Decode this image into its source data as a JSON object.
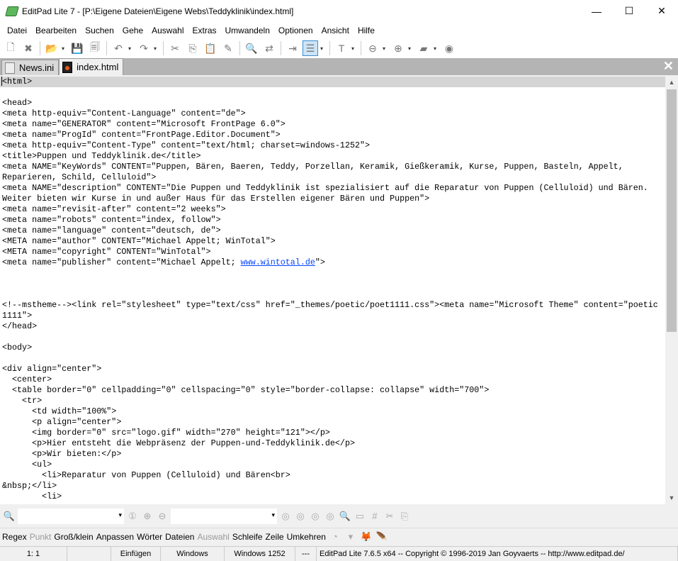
{
  "window": {
    "title": "EditPad Lite 7 - [P:\\Eigene Dateien\\Eigene Webs\\Teddyklinik\\index.html]",
    "minimize": "—",
    "maximize": "☐",
    "close": "✕"
  },
  "menu": [
    "Datei",
    "Bearbeiten",
    "Suchen",
    "Gehe",
    "Auswahl",
    "Extras",
    "Umwandeln",
    "Optionen",
    "Ansicht",
    "Hilfe"
  ],
  "toolbar": [
    {
      "name": "new-file-icon",
      "g": "🗋"
    },
    {
      "name": "close-file-icon",
      "g": "✖"
    },
    {
      "sep": true
    },
    {
      "name": "open-file-icon",
      "g": "📂",
      "dd": true
    },
    {
      "name": "save-icon",
      "g": "💾"
    },
    {
      "name": "save-all-icon",
      "g": "🗐"
    },
    {
      "sep": true
    },
    {
      "name": "undo-icon",
      "g": "↶",
      "dd": true
    },
    {
      "name": "redo-icon",
      "g": "↷",
      "dd": true
    },
    {
      "sep": true
    },
    {
      "name": "cut-icon",
      "g": "✂"
    },
    {
      "name": "copy-icon",
      "g": "⎘"
    },
    {
      "name": "paste-icon",
      "g": "📋"
    },
    {
      "name": "edit-icon",
      "g": "✎"
    },
    {
      "sep": true
    },
    {
      "name": "search-icon",
      "g": "🔍"
    },
    {
      "name": "replace-icon",
      "g": "⇄"
    },
    {
      "sep": true
    },
    {
      "name": "indent-icon",
      "g": "⇥"
    },
    {
      "name": "word-wrap-icon",
      "g": "☰",
      "sel": true,
      "dd": true
    },
    {
      "sep": true
    },
    {
      "name": "font-icon",
      "g": "T",
      "dd": true
    },
    {
      "sep": true
    },
    {
      "name": "back-icon",
      "g": "⊖",
      "dd": true
    },
    {
      "name": "forward-icon",
      "g": "⊕",
      "dd": true
    },
    {
      "name": "clip-collection-icon",
      "g": "▰",
      "dd": true
    },
    {
      "name": "web-globe-icon",
      "g": "◉"
    }
  ],
  "tabs": [
    {
      "label": "News.ini",
      "active": false
    },
    {
      "label": "index.html",
      "active": true
    }
  ],
  "tab_close": "✕",
  "editor": {
    "lines": [
      {
        "t": "<html>"
      },
      {
        "t": ""
      },
      {
        "t": "<head>"
      },
      {
        "t": "<meta http-equiv=\"Content-Language\" content=\"de\">"
      },
      {
        "t": "<meta name=\"GENERATOR\" content=\"Microsoft FrontPage 6.0\">"
      },
      {
        "t": "<meta name=\"ProgId\" content=\"FrontPage.Editor.Document\">"
      },
      {
        "t": "<meta http-equiv=\"Content-Type\" content=\"text/html; charset=windows-1252\">"
      },
      {
        "t": "<title>Puppen und Teddyklinik.de</title>"
      },
      {
        "t": "<meta NAME=\"KeyWords\" CONTENT=\"Puppen, Bären, Baeren, Teddy, Porzellan, Keramik, Gießkeramik, Kurse, Puppen, Basteln, Appelt,"
      },
      {
        "t": "Reparieren, Schild, Celluloid\">"
      },
      {
        "t": "<meta NAME=\"description\" CONTENT=\"Die Puppen und Teddyklinik ist spezialisiert auf die Reparatur von Puppen (Celluloid) und Bären."
      },
      {
        "t": "Weiter bieten wir Kurse in und außer Haus für das Erstellen eigener Bären und Puppen\">"
      },
      {
        "t": "<meta name=\"revisit-after\" content=\"2 weeks\">"
      },
      {
        "t": "<meta name=\"robots\" content=\"index, follow\">"
      },
      {
        "t": "<meta name=\"language\" content=\"deutsch, de\">"
      },
      {
        "t": "<META name=\"author\" CONTENT=\"Michael Appelt; WinTotal\">"
      },
      {
        "t": "<META name=\"copyright\" CONTENT=\"WinTotal\">"
      },
      {
        "t": "<meta name=\"publisher\" content=\"Michael Appelt; ",
        "link": "www.wintotal.de",
        "after": "\">"
      },
      {
        "t": ""
      },
      {
        "t": ""
      },
      {
        "t": ""
      },
      {
        "t": "<!--mstheme--><link rel=\"stylesheet\" type=\"text/css\" href=\"_themes/poetic/poet1111.css\"><meta name=\"Microsoft Theme\" content=\"poetic"
      },
      {
        "t": "1111\">"
      },
      {
        "t": "</head>"
      },
      {
        "t": ""
      },
      {
        "t": "<body>"
      },
      {
        "t": ""
      },
      {
        "t": "<div align=\"center\">"
      },
      {
        "t": "  <center>"
      },
      {
        "t": "  <table border=\"0\" cellpadding=\"0\" cellspacing=\"0\" style=\"border-collapse: collapse\" width=\"700\">"
      },
      {
        "t": "    <tr>"
      },
      {
        "t": "      <td width=\"100%\">"
      },
      {
        "t": "      <p align=\"center\">"
      },
      {
        "t": "      <img border=\"0\" src=\"logo.gif\" width=\"270\" height=\"121\"></p>"
      },
      {
        "t": "      <p>Hier entsteht die Webpräsenz der Puppen-und-Teddyklinik.de</p>"
      },
      {
        "t": "      <p>Wir bieten:</p>"
      },
      {
        "t": "      <ul>"
      },
      {
        "t": "        <li>Reparatur von Puppen (Celluloid) und Bären<br>"
      },
      {
        "t": "&nbsp;</li>"
      },
      {
        "t": "        <li>"
      }
    ]
  },
  "options": [
    {
      "label": "Regex",
      "on": true
    },
    {
      "label": "Punkt",
      "on": false
    },
    {
      "label": "Groß/klein",
      "on": true
    },
    {
      "label": "Anpassen",
      "on": true
    },
    {
      "label": "Wörter",
      "on": true
    },
    {
      "label": "Dateien",
      "on": true
    },
    {
      "label": "Auswahl",
      "on": false
    },
    {
      "label": "Schleife",
      "on": true
    },
    {
      "label": "Zeile",
      "on": true
    },
    {
      "label": "Umkehren",
      "on": true
    }
  ],
  "status": {
    "position": "1: 1",
    "blank": "",
    "mode": "Einfügen",
    "linebreak": "Windows",
    "encoding": "Windows 1252",
    "modified": "---",
    "about": "EditPad Lite 7.6.5 x64  --  Copyright © 1996-2019  Jan Goyvaerts  --  http://www.editpad.de/"
  }
}
